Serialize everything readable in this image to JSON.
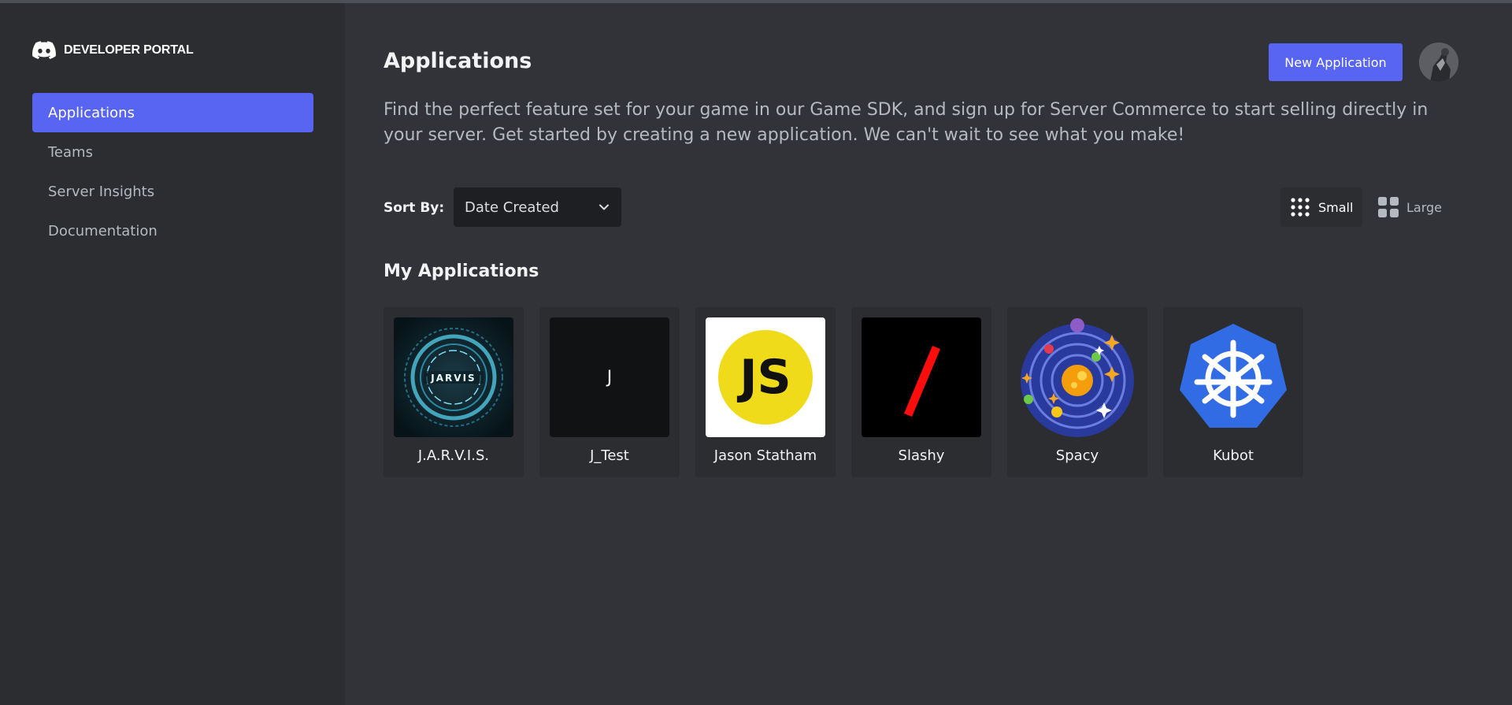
{
  "sidebar": {
    "brand": "DEVELOPER PORTAL",
    "items": [
      {
        "label": "Applications",
        "active": true
      },
      {
        "label": "Teams"
      },
      {
        "label": "Server Insights"
      },
      {
        "label": "Documentation"
      }
    ]
  },
  "header": {
    "title": "Applications",
    "new_app_label": "New Application",
    "description": "Find the perfect feature set for your game in our Game SDK, and sign up for Server Commerce to start selling directly in your server. Get started by creating a new application. We can't wait to see what you make!"
  },
  "sort": {
    "label": "Sort By:",
    "selected": "Date Created"
  },
  "view_toggle": {
    "small_label": "Small",
    "large_label": "Large",
    "selected": "Small"
  },
  "section": {
    "title": "My Applications"
  },
  "apps": [
    {
      "name": "J.A.R.V.I.S.",
      "icon_text": "JARVIS"
    },
    {
      "name": "J_Test",
      "icon_text": "J"
    },
    {
      "name": "Jason Statham",
      "icon_text": "JS"
    },
    {
      "name": "Slashy"
    },
    {
      "name": "Spacy"
    },
    {
      "name": "Kubot"
    }
  ],
  "colors": {
    "background": "#313338",
    "sidebar": "#2b2d31",
    "accent": "#5865f2",
    "card": "#2b2d31"
  }
}
